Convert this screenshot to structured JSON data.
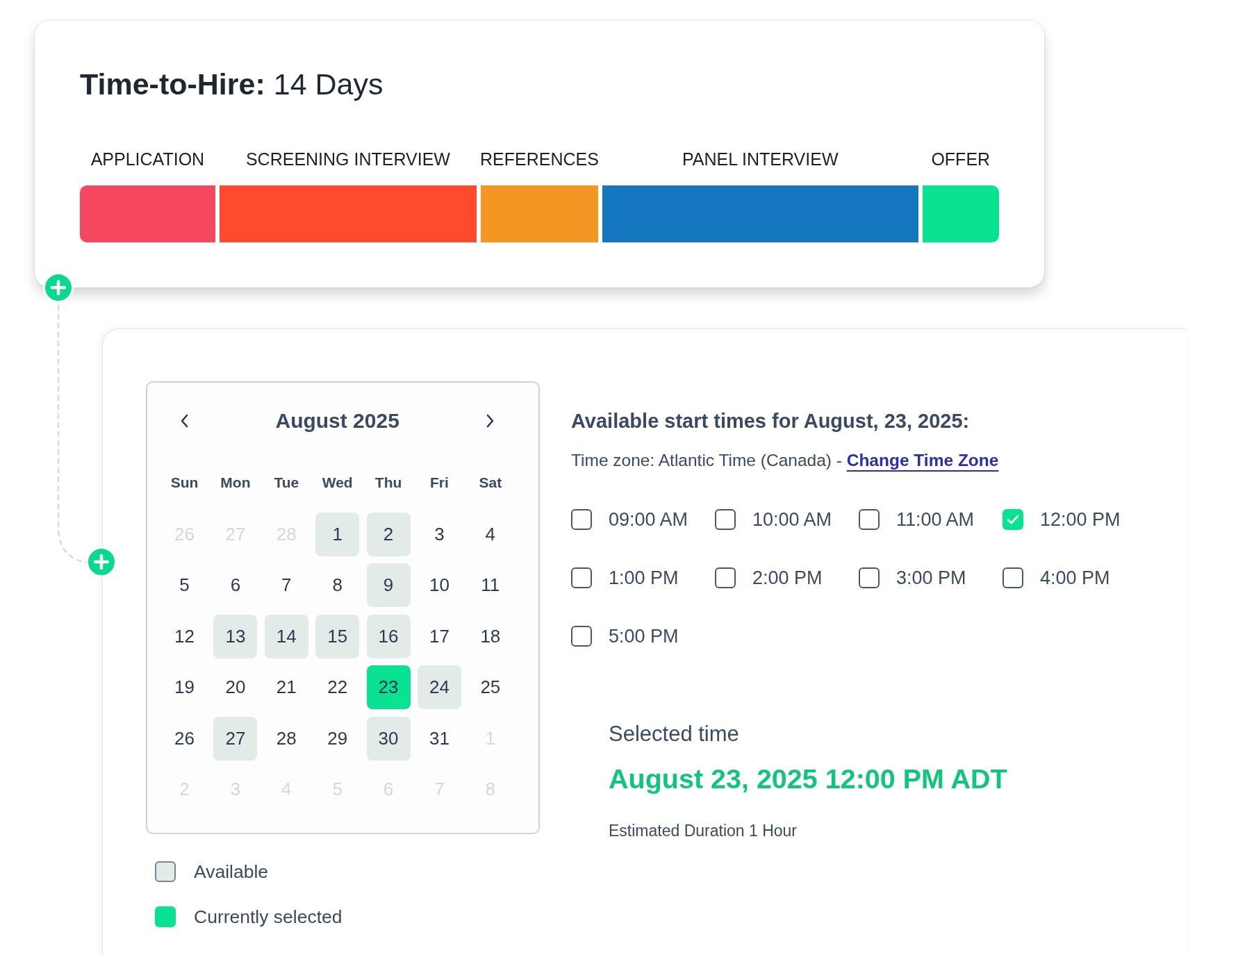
{
  "hiring_timeline": {
    "title": "**Time-to-Hire:** 14 Days",
    "stages": [
      {
        "label": "APPLICATION",
        "color": "#f64760"
      },
      {
        "label": "SCREENING INTERVIEW",
        "color": "#ff4a2f"
      },
      {
        "label": "REFERENCES",
        "color": "#f59622"
      },
      {
        "label": "PANEL INTERVIEW",
        "color": "#1577bf"
      },
      {
        "label": "OFFER",
        "color": "#08e291"
      }
    ]
  },
  "scheduler": {
    "calendar": {
      "month": "August 2025",
      "weekdays": [
        "Sun",
        "Mon",
        "Tue",
        "Wed",
        "Thu",
        "Fri",
        "Sat"
      ],
      "days": [
        {
          "label": "26",
          "in_month": false,
          "available": false,
          "selected": false
        },
        {
          "label": "27",
          "in_month": false,
          "available": false,
          "selected": false
        },
        {
          "label": "28",
          "in_month": false,
          "available": false,
          "selected": false
        },
        {
          "label": "1",
          "in_month": true,
          "available": true,
          "selected": false
        },
        {
          "label": "2",
          "in_month": true,
          "available": true,
          "selected": false
        },
        {
          "label": "3",
          "in_month": true,
          "available": false,
          "selected": false
        },
        {
          "label": "4",
          "in_month": true,
          "available": false,
          "selected": false
        },
        {
          "label": "5",
          "in_month": true,
          "available": false,
          "selected": false
        },
        {
          "label": "6",
          "in_month": true,
          "available": false,
          "selected": false
        },
        {
          "label": "7",
          "in_month": true,
          "available": false,
          "selected": false
        },
        {
          "label": "8",
          "in_month": true,
          "available": false,
          "selected": false
        },
        {
          "label": "9",
          "in_month": true,
          "available": true,
          "selected": false
        },
        {
          "label": "10",
          "in_month": true,
          "available": false,
          "selected": false
        },
        {
          "label": "11",
          "in_month": true,
          "available": false,
          "selected": false
        },
        {
          "label": "12",
          "in_month": true,
          "available": false,
          "selected": false
        },
        {
          "label": "13",
          "in_month": true,
          "available": true,
          "selected": false
        },
        {
          "label": "14",
          "in_month": true,
          "available": true,
          "selected": false
        },
        {
          "label": "15",
          "in_month": true,
          "available": true,
          "selected": false
        },
        {
          "label": "16",
          "in_month": true,
          "available": true,
          "selected": false
        },
        {
          "label": "17",
          "in_month": true,
          "available": false,
          "selected": false
        },
        {
          "label": "18",
          "in_month": true,
          "available": false,
          "selected": false
        },
        {
          "label": "19",
          "in_month": true,
          "available": false,
          "selected": false
        },
        {
          "label": "20",
          "in_month": true,
          "available": false,
          "selected": false
        },
        {
          "label": "21",
          "in_month": true,
          "available": false,
          "selected": false
        },
        {
          "label": "22",
          "in_month": true,
          "available": false,
          "selected": false
        },
        {
          "label": "23",
          "in_month": true,
          "available": true,
          "selected": true
        },
        {
          "label": "24",
          "in_month": true,
          "available": true,
          "selected": false
        },
        {
          "label": "25",
          "in_month": true,
          "available": false,
          "selected": false
        },
        {
          "label": "26",
          "in_month": true,
          "available": false,
          "selected": false
        },
        {
          "label": "27",
          "in_month": true,
          "available": true,
          "selected": false
        },
        {
          "label": "28",
          "in_month": true,
          "available": false,
          "selected": false
        },
        {
          "label": "29",
          "in_month": true,
          "available": false,
          "selected": false
        },
        {
          "label": "30",
          "in_month": true,
          "available": true,
          "selected": false
        },
        {
          "label": "31",
          "in_month": true,
          "available": false,
          "selected": false
        },
        {
          "label": "1",
          "in_month": false,
          "available": false,
          "selected": false
        },
        {
          "label": "2",
          "in_month": false,
          "available": false,
          "selected": false
        },
        {
          "label": "3",
          "in_month": false,
          "available": false,
          "selected": false
        },
        {
          "label": "4",
          "in_month": false,
          "available": false,
          "selected": false
        },
        {
          "label": "5",
          "in_month": false,
          "available": false,
          "selected": false
        },
        {
          "label": "6",
          "in_month": false,
          "available": false,
          "selected": false
        },
        {
          "label": "7",
          "in_month": false,
          "available": false,
          "selected": false
        },
        {
          "label": "8",
          "in_month": false,
          "available": false,
          "selected": false
        }
      ]
    },
    "legend": [
      {
        "label": "Available",
        "kind": "available"
      },
      {
        "label": "Currently selected",
        "kind": "selected"
      }
    ],
    "times_heading": "Available start times for August, 23, 2025:",
    "timezone": {
      "text": "Time zone: Atlantic Time (Canada) -",
      "link": "Change Time Zone"
    },
    "time_slots": [
      {
        "label": "09:00 AM",
        "checked": false
      },
      {
        "label": "10:00 AM",
        "checked": false
      },
      {
        "label": "11:00 AM",
        "checked": false
      },
      {
        "label": "12:00 PM",
        "checked": true
      },
      {
        "label": "1:00 PM",
        "checked": false
      },
      {
        "label": "2:00 PM",
        "checked": false
      },
      {
        "label": "3:00 PM",
        "checked": false
      },
      {
        "label": "4:00 PM",
        "checked": false
      },
      {
        "label": "5:00 PM",
        "checked": false
      }
    ],
    "selected_time": {
      "heading": "Selected time",
      "value": "August 23, 2025 12:00 PM ADT",
      "duration": "Estimated Duration 1 Hour"
    }
  }
}
